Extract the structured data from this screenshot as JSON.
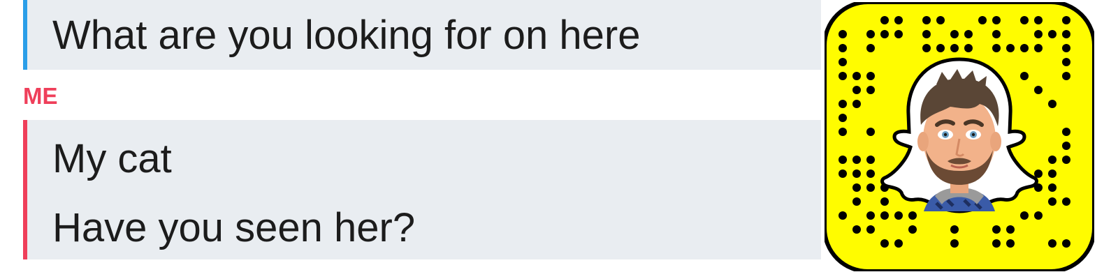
{
  "chat": {
    "messages_them": [
      "What are you looking for on here"
    ],
    "sender_me": "ME",
    "messages_me": [
      "My cat",
      "Have you seen her?"
    ]
  },
  "colors": {
    "them_accent": "#2b9ee8",
    "me_accent": "#ef3f5a",
    "bubble_bg": "#e9edf1",
    "snapcode_yellow": "#fffc00"
  },
  "snapcode": {
    "icon": "snapcode-ghost-icon",
    "avatar": "bitmoji-avatar"
  }
}
